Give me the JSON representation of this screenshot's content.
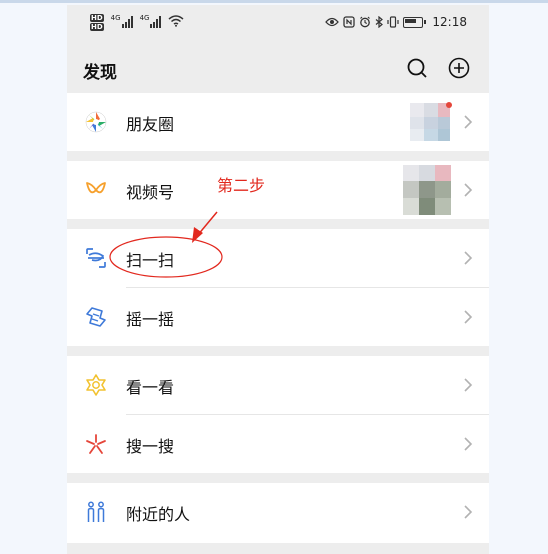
{
  "status": {
    "hd1": "HD",
    "hd2": "HD",
    "sig1": "4G",
    "sig2": "4G",
    "time": "12:18"
  },
  "header": {
    "title": "发现",
    "search_icon": "search-icon",
    "add_icon": "plus-circle-icon"
  },
  "items": [
    {
      "label": "朋友圈",
      "icon": "moments-icon"
    },
    {
      "label": "视频号",
      "icon": "channels-icon"
    },
    {
      "label": "扫一扫",
      "icon": "scan-icon"
    },
    {
      "label": "摇一摇",
      "icon": "shake-icon"
    },
    {
      "label": "看一看",
      "icon": "top-stories-icon"
    },
    {
      "label": "搜一搜",
      "icon": "search-discover-icon"
    },
    {
      "label": "附近的人",
      "icon": "people-nearby-icon"
    }
  ],
  "annotation": {
    "text": "第二步",
    "color": "#e2281e"
  },
  "colors": {
    "accent_red": "#e2281e",
    "moments_green": "#2aae67",
    "channels_orange": "#f6a02c",
    "scan_blue": "#3f7ad9",
    "look_yellow": "#f2c230",
    "search_red": "#e5463a"
  }
}
